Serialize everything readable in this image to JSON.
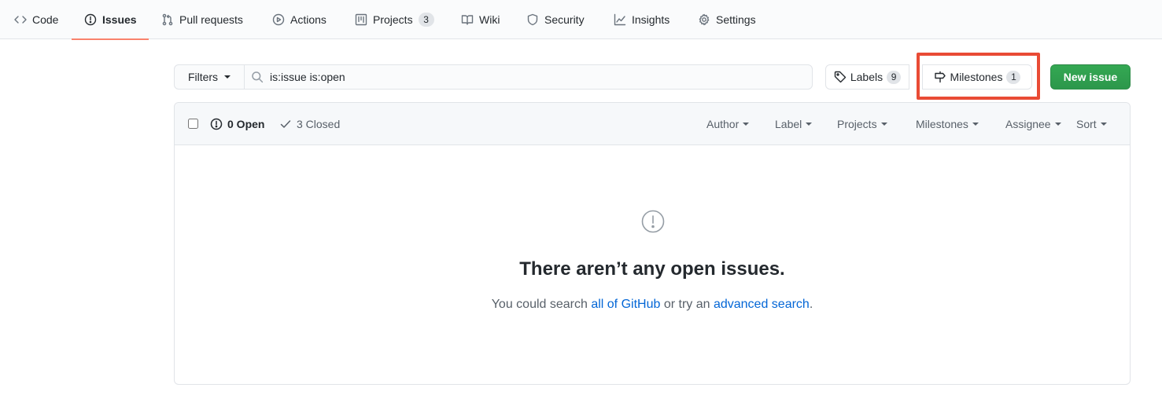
{
  "nav": {
    "items": [
      {
        "label": "Code",
        "icon": "code-icon"
      },
      {
        "label": "Issues",
        "icon": "issue-opened-icon",
        "selected": true
      },
      {
        "label": "Pull requests",
        "icon": "git-pull-request-icon"
      },
      {
        "label": "Actions",
        "icon": "play-icon"
      },
      {
        "label": "Projects",
        "icon": "project-icon",
        "count": "3"
      },
      {
        "label": "Wiki",
        "icon": "book-icon"
      },
      {
        "label": "Security",
        "icon": "shield-icon"
      },
      {
        "label": "Insights",
        "icon": "graph-icon"
      },
      {
        "label": "Settings",
        "icon": "gear-icon"
      }
    ]
  },
  "subnav": {
    "filters_label": "Filters",
    "search_value": "is:issue is:open",
    "labels_label": "Labels",
    "labels_count": "9",
    "milestones_label": "Milestones",
    "milestones_count": "1",
    "new_issue_label": "New issue"
  },
  "issues_header": {
    "open_label": "0 Open",
    "closed_label": "3 Closed",
    "filters": [
      "Author",
      "Label",
      "Projects",
      "Milestones",
      "Assignee",
      "Sort"
    ]
  },
  "blankslate": {
    "title": "There aren’t any open issues.",
    "desc_prefix": "You could search ",
    "link_all": "all of GitHub",
    "desc_middle": " or try an ",
    "link_advanced": "advanced search",
    "desc_suffix": "."
  },
  "colors": {
    "accent_underline": "#f9826c",
    "primary_button": "#2ea44f",
    "link": "#0366d6",
    "highlight": "#e94b35"
  }
}
